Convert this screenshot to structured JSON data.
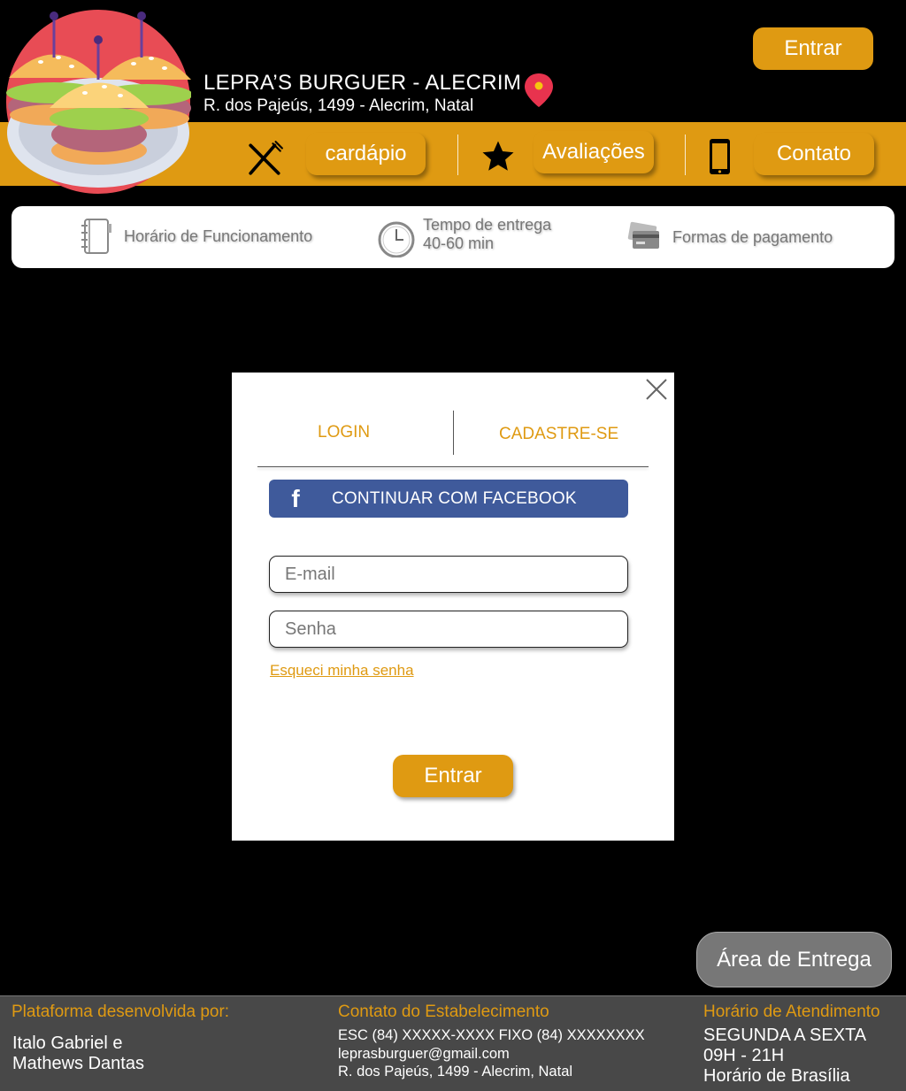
{
  "header": {
    "title": "LEPRA’S BURGUER - ALECRIM",
    "address": "R. dos Pajeús, 1499 - Alecrim, Natal",
    "login_button": "Entrar"
  },
  "nav": {
    "menu_label": "cardápio",
    "reviews_label": "Avaliações",
    "contact_label": "Contato"
  },
  "info_bar": {
    "hours_label": "Horário de Funcionamento",
    "delivery_time_label": "Tempo de entrega",
    "delivery_time_value": "40-60 min",
    "payment_label": "Formas de pagamento"
  },
  "modal": {
    "tab_login": "LOGIN",
    "tab_signup": "CADASTRE-SE",
    "facebook_label": "CONTINUAR COM FACEBOOK",
    "email_placeholder": "E-mail",
    "password_placeholder": "Senha",
    "forgot_label": "Esqueci minha senha",
    "submit_label": "Entrar"
  },
  "delivery_area_label": "Área de Entrega",
  "footer": {
    "dev_heading": "Plataforma desenvolvida por:",
    "dev_line1": "Italo Gabriel e",
    "dev_line2": "Mathews Dantas",
    "contact_heading": "Contato do Estabelecimento",
    "contact_phone": "ESC (84) XXXXX-XXXX FIXO (84) XXXXXXXX",
    "contact_email": "leprasburguer@gmail.com",
    "contact_address": "R. dos Pajeús, 1499 - Alecrim, Natal",
    "hours_heading": "Horário de Atendimento",
    "hours_days": "SEGUNDA A SEXTA",
    "hours_time": "09H - 21H",
    "hours_tz": "Horário de Brasília"
  },
  "colors": {
    "accent": "#df9a12",
    "facebook": "#3f5a9b",
    "footer_bg": "#484848"
  },
  "icons": [
    "burger-logo-icon",
    "location-pin-icon",
    "fork-knife-icon",
    "star-icon",
    "phone-icon",
    "notebook-icon",
    "clock-icon",
    "credit-cards-icon",
    "close-icon",
    "facebook-icon"
  ]
}
